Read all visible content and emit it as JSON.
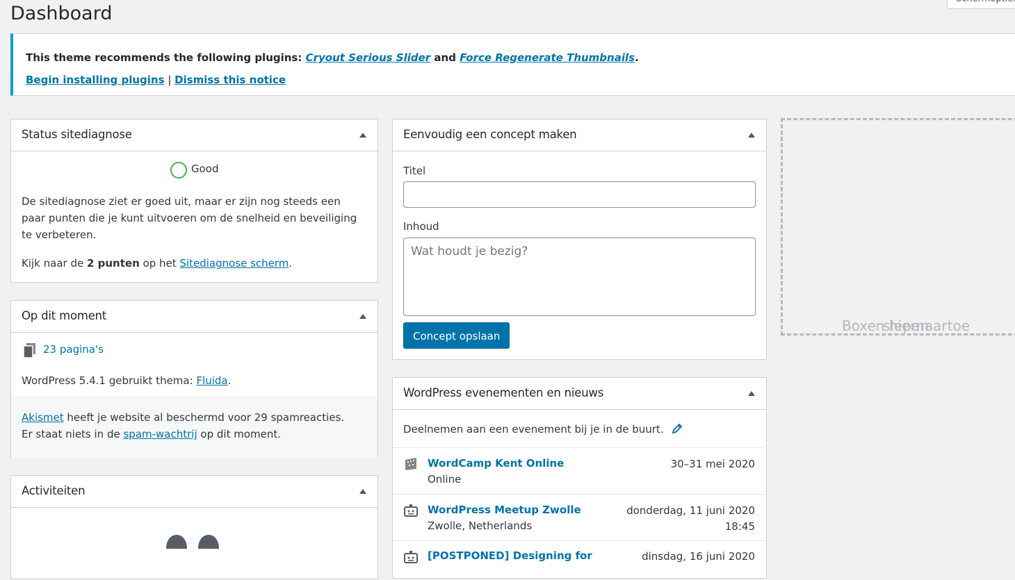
{
  "page": {
    "title": "Dashboard",
    "screen_options_label": "Schermopties"
  },
  "notice": {
    "prefix": "This theme recommends the following plugins: ",
    "plugin1": "Cryout Serious Slider",
    "and": " and ",
    "plugin2": "Force Regenerate Thumbnails",
    "suffix": ".",
    "begin_link": "Begin installing plugins",
    "separator": " | ",
    "dismiss_link": "Dismiss this notice"
  },
  "site_health": {
    "title": "Status sitediagnose",
    "status": "Good",
    "description": "De sitediagnose ziet er goed uit, maar er zijn nog steeds een paar punten die je kunt uitvoeren om de snelheid en beveiliging te verbeteren.",
    "look_prefix": "Kijk naar de ",
    "look_bold": "2 punten",
    "look_middle": " op het ",
    "look_link": "Sitediagnose scherm",
    "look_suffix": "."
  },
  "at_a_glance": {
    "title": "Op dit moment",
    "pages_link": "23 pagina's",
    "wp_version_text": "WordPress 5.4.1 gebruikt thema: ",
    "theme_link": "Fluida",
    "theme_suffix": ".",
    "akismet_link": "Akismet",
    "akismet_text": " heeft je website al beschermd voor 29 spamreacties.",
    "spam_prefix": "Er staat niets in de ",
    "spam_link": "spam-wachtrij",
    "spam_suffix": " op dit moment."
  },
  "activity": {
    "title": "Activiteiten"
  },
  "quick_draft": {
    "title": "Eenvoudig een concept maken",
    "title_label": "Titel",
    "content_label": "Inhoud",
    "content_placeholder": "Wat houdt je bezig?",
    "save_button": "Concept opslaan"
  },
  "events": {
    "title": "WordPress evenementen en nieuws",
    "intro": "Deelnemen aan een evenement bij je in de buurt.",
    "items": [
      {
        "title": "WordCamp Kent Online",
        "location": "Online",
        "date": "30–31 mei 2020",
        "time": ""
      },
      {
        "title": "WordPress Meetup Zwolle",
        "location": "Zwolle, Netherlands",
        "date": "donderdag, 11 juni 2020",
        "time": "18:45"
      },
      {
        "title": "[POSTPONED] Designing for",
        "location": "",
        "date": "dinsdag, 16 juni 2020",
        "time": ""
      }
    ]
  },
  "dropzone": {
    "line1": "Boxen hiernaartoe",
    "line2": "slepen"
  },
  "colors": {
    "accent": "#0073aa",
    "notice_border": "#00a0d2",
    "good": "#46b450"
  }
}
